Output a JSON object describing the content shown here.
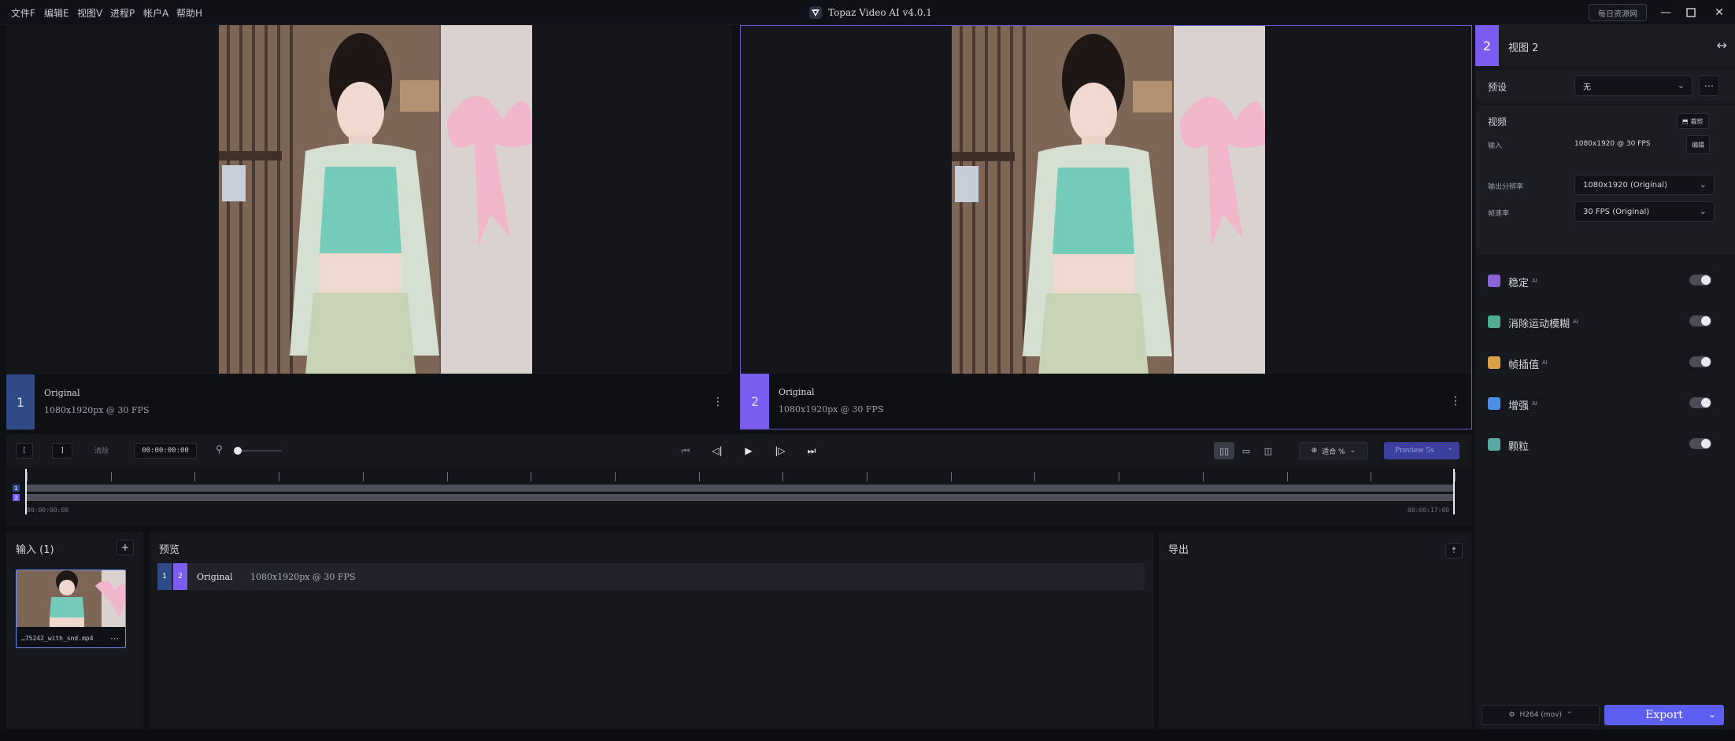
{
  "window": {
    "title": "Topaz Video AI  v4.0.1",
    "daily_button": "每日资源网"
  },
  "menu": [
    "文件F",
    "编辑E",
    "视图V",
    "进程P",
    "帐户A",
    "帮助H"
  ],
  "panes": [
    {
      "num": "1",
      "title": "Original",
      "sub": "1080x1920px @ 30 FPS",
      "color": "#2f4a86"
    },
    {
      "num": "2",
      "title": "Original",
      "sub": "1080x1920px @ 30 FPS",
      "color": "#7a5df0"
    }
  ],
  "transport": {
    "start_box": "[",
    "frame_box": "]",
    "clear_label": "清除",
    "timecode": "00:00:00:00",
    "fit_label": "适合 %",
    "preview_label": "Preview 5s"
  },
  "timeline": {
    "start_time": "00:00:00:00",
    "end_time": "00:00:17:00"
  },
  "inputs_panel": {
    "title": "输入 (1)",
    "file_name": "…75242_with_snd.mp4"
  },
  "preview_panel": {
    "title": "预览",
    "row_title": "Original",
    "row_sub": "1080x1920px @ 30 FPS"
  },
  "export_panel": {
    "title": "导出"
  },
  "settings": {
    "view_num": "2",
    "view_title": "视图 2",
    "preset_label": "预设",
    "preset_value": "无",
    "video_label": "视频",
    "crop_label": "裁剪",
    "input_label": "输入",
    "input_value": "1080x1920 @ 30 FPS",
    "edit_label": "编辑",
    "output_res_label": "输出分辨率",
    "output_res_value": "1080x1920 (Original)",
    "fps_label": "帧速率",
    "fps_value": "30 FPS (Original)",
    "ai_features": [
      {
        "label": "稳定",
        "ai": "AI",
        "color": "#8b63d9",
        "icon": "stabilize-icon"
      },
      {
        "label": "消除运动模糊",
        "ai": "AI",
        "color": "#4fae8f",
        "icon": "motion-deblur-icon"
      },
      {
        "label": "帧插值",
        "ai": "AI",
        "color": "#d9a046",
        "icon": "frame-interpolation-icon"
      },
      {
        "label": "增强",
        "ai": "AI",
        "color": "#4d8ee8",
        "icon": "enhance-icon"
      },
      {
        "label": "颗粒",
        "ai": "",
        "color": "#5aa9a2",
        "icon": "grain-icon"
      }
    ],
    "codec_label": "H264 (mov)",
    "export_label": "Export"
  }
}
